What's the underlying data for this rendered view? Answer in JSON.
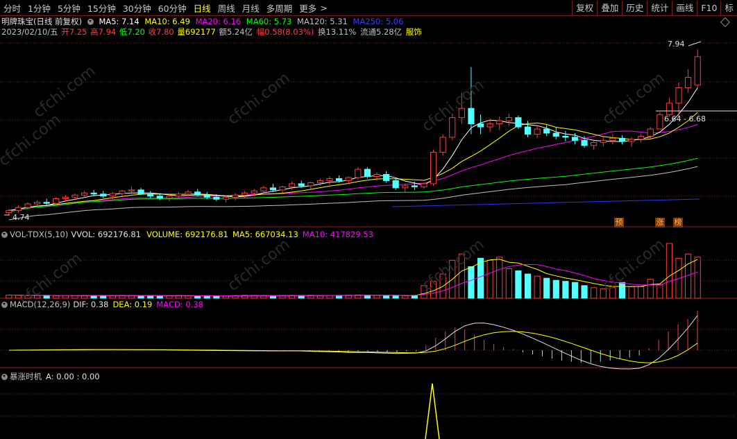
{
  "toolbar": {
    "periods": [
      "分时",
      "1分钟",
      "5分钟",
      "15分钟",
      "30分钟",
      "60分钟",
      "日线",
      "周线",
      "月线",
      "多周期",
      "更多"
    ],
    "active_period": "日线",
    "more_arrow": ">",
    "right_buttons": [
      "复权",
      "叠加",
      "历史",
      "统计",
      "画线",
      "F10",
      "标"
    ]
  },
  "stock": {
    "name": "明牌珠宝(日线 前复权)",
    "ma5": "MA5: 7.14",
    "ma10": "MA10: 6.49",
    "ma20": "MA20: 6.16",
    "ma60": "MA60: 5.73",
    "ma120": "MA120: 5.31",
    "ma250": "MA250: 5.06",
    "date": "2023/02/10/五",
    "open": "开7.25",
    "high": "高7.94",
    "low": "低7.20",
    "close": "收7.80",
    "volume": "量692177",
    "amount": "额5.24亿",
    "change": "幅0.58(8.03%)",
    "turnover": "换13.11%",
    "float": "流通5.28亿",
    "sector": "服饰"
  },
  "annotations": {
    "high_label": "7.94",
    "low_label": "4.74",
    "range_label": "6.64 - 6.68",
    "signal_1": "预",
    "signal_2": "涨",
    "signal_3": "榜"
  },
  "volume_panel": {
    "name": "VOL-TDX(5,10)",
    "vvol": "VVOL: 692176.81",
    "volume": "VOLUME: 692176.81",
    "ma5": "MA5: 667034.13",
    "ma10": "MA10: 417829.53"
  },
  "macd_panel": {
    "name": "MACD(12,26,9)",
    "dif": "DIF: 0.38",
    "dea": "DEA: 0.19",
    "macd": "MACD: 0.38"
  },
  "signal_panel": {
    "name": "暴涨时机",
    "value": "A: 0.00 : 0.00"
  },
  "watermark": "cfchi.com",
  "colors": {
    "up": "#ff3c3c",
    "down": "#54ffff",
    "ma5": "#ffffff",
    "ma10": "#ffff00",
    "ma20": "#ff00ff",
    "ma60": "#00ff00",
    "ma120": "#c0c0c0",
    "ma250": "#3030ff",
    "grid": "#7a1a1a"
  },
  "chart_data": {
    "type": "candlestick",
    "price_range": [
      4.6,
      8.2
    ],
    "candles_ohlc": [
      [
        4.78,
        4.85,
        4.74,
        4.82
      ],
      [
        4.82,
        4.92,
        4.78,
        4.88
      ],
      [
        4.88,
        4.98,
        4.84,
        4.95
      ],
      [
        4.95,
        5.02,
        4.9,
        4.98
      ],
      [
        4.98,
        5.05,
        4.92,
        4.96
      ],
      [
        4.96,
        5.08,
        4.93,
        5.05
      ],
      [
        5.05,
        5.12,
        5.0,
        5.08
      ],
      [
        5.08,
        5.15,
        5.02,
        5.12
      ],
      [
        5.12,
        5.2,
        5.06,
        5.16
      ],
      [
        5.16,
        5.22,
        5.1,
        5.14
      ],
      [
        5.14,
        5.2,
        5.06,
        5.1
      ],
      [
        5.1,
        5.18,
        5.04,
        5.15
      ],
      [
        5.15,
        5.22,
        5.1,
        5.2
      ],
      [
        5.2,
        5.28,
        5.14,
        5.22
      ],
      [
        5.22,
        5.26,
        5.12,
        5.14
      ],
      [
        5.14,
        5.2,
        5.06,
        5.1
      ],
      [
        5.1,
        5.16,
        5.02,
        5.06
      ],
      [
        5.06,
        5.14,
        5.0,
        5.1
      ],
      [
        5.1,
        5.18,
        5.05,
        5.14
      ],
      [
        5.14,
        5.22,
        5.1,
        5.18
      ],
      [
        5.18,
        5.24,
        5.1,
        5.12
      ],
      [
        5.12,
        5.18,
        5.04,
        5.08
      ],
      [
        5.08,
        5.14,
        5.0,
        5.04
      ],
      [
        5.04,
        5.12,
        4.98,
        5.08
      ],
      [
        5.08,
        5.16,
        5.02,
        5.12
      ],
      [
        5.12,
        5.2,
        5.06,
        5.16
      ],
      [
        5.16,
        5.24,
        5.1,
        5.2
      ],
      [
        5.2,
        5.3,
        5.14,
        5.26
      ],
      [
        5.26,
        5.34,
        5.18,
        5.22
      ],
      [
        5.22,
        5.3,
        5.16,
        5.28
      ],
      [
        5.28,
        5.38,
        5.22,
        5.34
      ],
      [
        5.34,
        5.4,
        5.26,
        5.3
      ],
      [
        5.3,
        5.38,
        5.24,
        5.36
      ],
      [
        5.36,
        5.44,
        5.3,
        5.4
      ],
      [
        5.4,
        5.48,
        5.32,
        5.44
      ],
      [
        5.44,
        5.5,
        5.36,
        5.4
      ],
      [
        5.4,
        5.48,
        5.34,
        5.46
      ],
      [
        5.46,
        5.66,
        5.42,
        5.62
      ],
      [
        5.62,
        5.66,
        5.44,
        5.48
      ],
      [
        5.48,
        5.56,
        5.4,
        5.52
      ],
      [
        5.52,
        5.58,
        5.36,
        5.4
      ],
      [
        5.4,
        5.46,
        5.22,
        5.26
      ],
      [
        5.26,
        5.34,
        5.18,
        5.3
      ],
      [
        5.3,
        5.38,
        5.22,
        5.28
      ],
      [
        5.28,
        5.36,
        5.24,
        5.34
      ],
      [
        5.34,
        6.0,
        5.3,
        5.95
      ],
      [
        5.95,
        6.3,
        5.88,
        6.24
      ],
      [
        6.24,
        6.7,
        6.18,
        6.62
      ],
      [
        6.62,
        7.1,
        6.5,
        6.8
      ],
      [
        6.8,
        7.6,
        6.3,
        6.5
      ],
      [
        6.5,
        6.68,
        6.3,
        6.44
      ],
      [
        6.44,
        6.6,
        6.34,
        6.5
      ],
      [
        6.5,
        6.64,
        6.38,
        6.56
      ],
      [
        6.56,
        6.7,
        6.46,
        6.62
      ],
      [
        6.62,
        6.66,
        6.4,
        6.44
      ],
      [
        6.44,
        6.56,
        6.24,
        6.3
      ],
      [
        6.3,
        6.48,
        6.22,
        6.4
      ],
      [
        6.4,
        6.48,
        6.26,
        6.32
      ],
      [
        6.32,
        6.44,
        6.2,
        6.26
      ],
      [
        6.26,
        6.36,
        6.16,
        6.24
      ],
      [
        6.24,
        6.32,
        6.1,
        6.18
      ],
      [
        6.18,
        6.26,
        6.04,
        6.08
      ],
      [
        6.08,
        6.2,
        6.0,
        6.14
      ],
      [
        6.14,
        6.24,
        6.06,
        6.18
      ],
      [
        6.18,
        6.3,
        6.1,
        6.22
      ],
      [
        6.22,
        6.28,
        6.1,
        6.16
      ],
      [
        6.16,
        6.24,
        6.06,
        6.2
      ],
      [
        6.2,
        6.3,
        6.14,
        6.26
      ],
      [
        6.26,
        6.44,
        6.2,
        6.4
      ],
      [
        6.4,
        6.72,
        6.6,
        6.68
      ],
      [
        6.68,
        7.0,
        6.64,
        6.9
      ],
      [
        6.9,
        7.3,
        6.64,
        7.2
      ],
      [
        7.2,
        7.56,
        7.1,
        7.4
      ],
      [
        7.25,
        7.94,
        7.2,
        7.8
      ]
    ],
    "volume": [
      30,
      28,
      26,
      25,
      27,
      24,
      26,
      25,
      23,
      24,
      26,
      25,
      27,
      24,
      22,
      25,
      23,
      24,
      26,
      22,
      21,
      24,
      23,
      22,
      25,
      27,
      26,
      24,
      23,
      25,
      27,
      26,
      28,
      24,
      26,
      27,
      29,
      31,
      28,
      27,
      26,
      25,
      24,
      27,
      120,
      160,
      230,
      360,
      420,
      300,
      380,
      360,
      390,
      280,
      260,
      230,
      210,
      190,
      170,
      160,
      150,
      120,
      100,
      90,
      100,
      150,
      110,
      110,
      180,
      130,
      520,
      380,
      420,
      390
    ],
    "macd_hist": [
      0,
      0,
      0,
      0,
      0,
      0,
      0,
      0,
      0,
      0,
      0,
      0,
      0,
      0,
      0,
      0,
      0,
      0,
      0,
      0,
      0,
      0,
      0,
      0,
      0,
      0,
      0,
      0,
      0,
      0,
      0,
      -0.01,
      -0.01,
      -0.01,
      -0.01,
      -0.02,
      -0.01,
      -0.01,
      -0.02,
      -0.02,
      -0.02,
      -0.01,
      -0.01,
      0.05,
      0.12,
      0.18,
      0.22,
      0.2,
      0.15,
      0.1,
      0.06,
      0.03,
      0.01,
      -0.02,
      -0.04,
      -0.06,
      -0.08,
      -0.1,
      -0.11,
      -0.12,
      -0.12,
      -0.11,
      -0.1,
      -0.08,
      -0.07,
      -0.05,
      0.02,
      0.1,
      0.18,
      0.25,
      0.3,
      0.38
    ],
    "signal_spike_index": 44
  }
}
